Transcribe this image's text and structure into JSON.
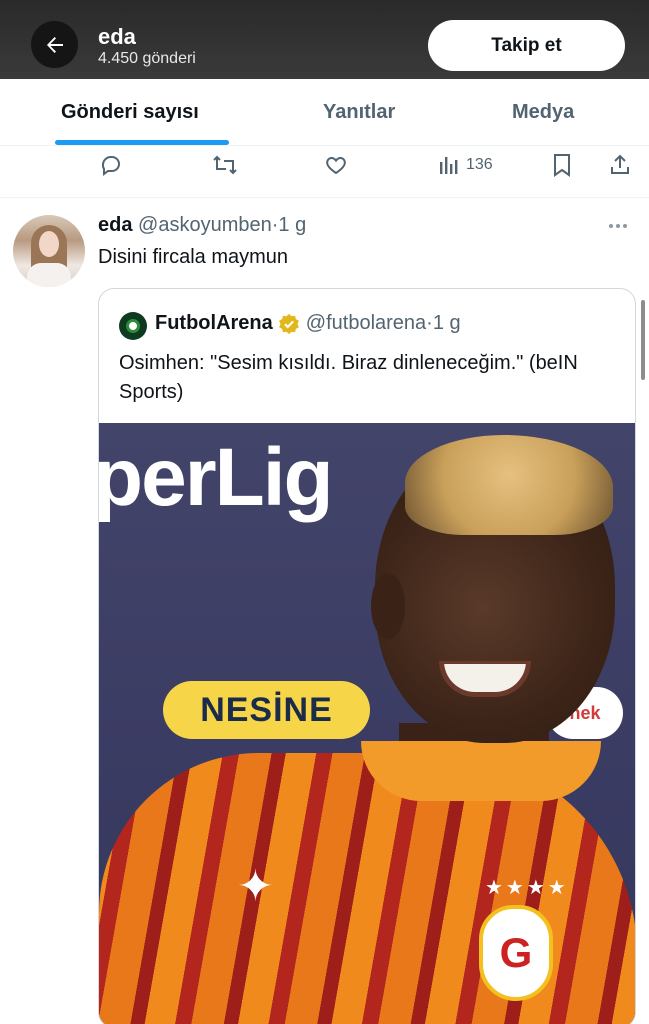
{
  "header": {
    "name": "eda",
    "post_count": "4.450 gönderi",
    "follow_label": "Takip et"
  },
  "tabs": [
    {
      "label": "Gönderi sayısı",
      "active": true
    },
    {
      "label": "Yanıtlar",
      "active": false
    },
    {
      "label": "Medya",
      "active": false
    }
  ],
  "previous_tweet": {
    "views": "136"
  },
  "tweet": {
    "author_name": "eda",
    "handle": "@askoyumben",
    "separator": "·",
    "time": "1 g",
    "text": "Disini fircala maymun",
    "quote": {
      "author_name": "FutbolArena",
      "handle": "@futbolarena",
      "separator": "·",
      "time": "1 g",
      "verified": true,
      "text": "Osimhen: \"Sesim kısıldı. Biraz dinleneceğim.\" (beIN Sports)",
      "photo": {
        "backdrop_text": "perLig",
        "sponsor": "NESİNE",
        "sponsor_2": "nek"
      }
    }
  },
  "colors": {
    "accent": "#1d9bf0",
    "muted": "#536471",
    "verified_gold": "#e2b719"
  }
}
